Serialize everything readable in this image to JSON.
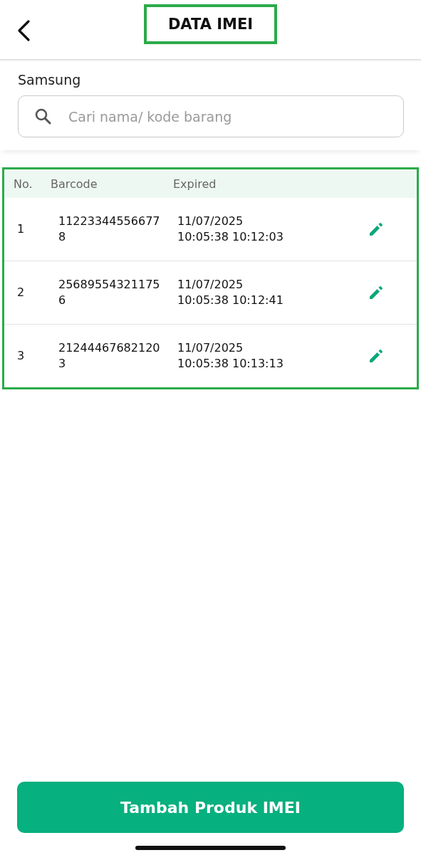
{
  "header": {
    "title": "DATA IMEI",
    "highlighted": true
  },
  "store": {
    "label": "Samsung"
  },
  "search": {
    "placeholder": "Cari nama/ kode barang"
  },
  "table": {
    "highlighted": true,
    "columns": [
      "No.",
      "Barcode",
      "Expired"
    ],
    "rows": [
      {
        "no": "1",
        "barcode": "112233445566778",
        "date": "11/07/2025",
        "time": "10:05:38 10:12:03"
      },
      {
        "no": "2",
        "barcode": "256895543211756",
        "date": "11/07/2025",
        "time": "10:05:38 10:12:41"
      },
      {
        "no": "3",
        "barcode": "212444676821203",
        "date": "11/07/2025",
        "time": "10:05:38 10:13:13"
      }
    ]
  },
  "button": {
    "label": "Tambah Produk IMEI"
  }
}
